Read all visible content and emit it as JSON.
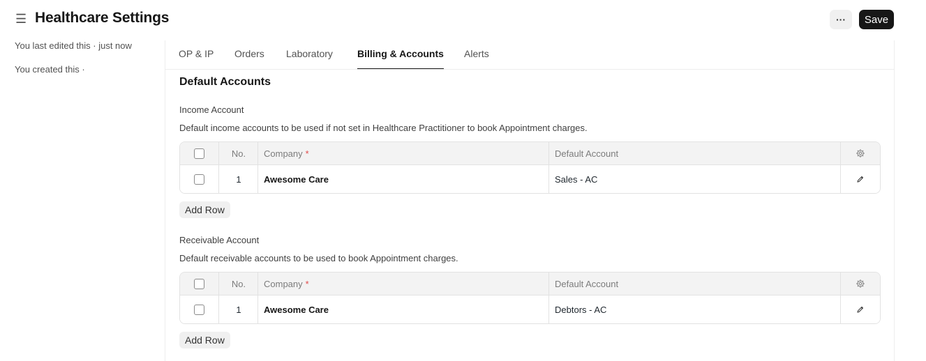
{
  "header": {
    "title": "Healthcare Settings",
    "more_label": "···",
    "save_label": "Save"
  },
  "sidebar": {
    "last_edited": "You last edited this · just now",
    "created": "You created this ·"
  },
  "tabs": [
    {
      "label": "OP & IP",
      "active": false
    },
    {
      "label": "Orders",
      "active": false
    },
    {
      "label": "Laboratory",
      "active": false
    },
    {
      "label": "Billing & Accounts",
      "active": true
    },
    {
      "label": "Alerts",
      "active": false
    }
  ],
  "section": {
    "title": "Default Accounts"
  },
  "income": {
    "label": "Income Account",
    "description": "Default income accounts to be used if not set in Healthcare Practitioner to book Appointment charges.",
    "columns": {
      "no": "No.",
      "company": "Company",
      "required_mark": "*",
      "account": "Default Account"
    },
    "rows": [
      {
        "no": "1",
        "company": "Awesome Care",
        "account": "Sales - AC"
      }
    ],
    "add_row_label": "Add Row"
  },
  "receivable": {
    "label": "Receivable Account",
    "description": "Default receivable accounts to be used to book Appointment charges.",
    "columns": {
      "no": "No.",
      "company": "Company",
      "required_mark": "*",
      "account": "Default Account"
    },
    "rows": [
      {
        "no": "1",
        "company": "Awesome Care",
        "account": "Debtors - AC"
      }
    ],
    "add_row_label": "Add Row"
  },
  "icons": {
    "menu": "hamburger-icon",
    "settings": "gear-icon",
    "edit": "pencil-icon"
  },
  "colors": {
    "primary_button": "#171717",
    "required": "#e24c4c",
    "grid_header": "#f3f3f3"
  }
}
